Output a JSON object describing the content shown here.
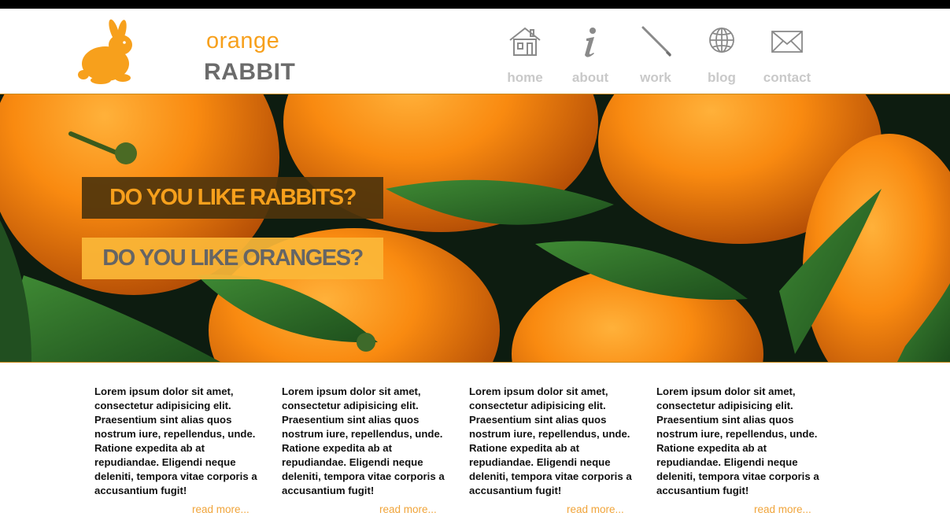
{
  "brand": {
    "line1": "orange",
    "line2": "RABBIT"
  },
  "colors": {
    "accent": "#f7a01c",
    "text_gray": "#6b6b6b",
    "nav_gray": "#c9c9c9"
  },
  "nav": [
    {
      "label": "home",
      "icon": "house-icon"
    },
    {
      "label": "about",
      "icon": "info-icon"
    },
    {
      "label": "work",
      "icon": "pencil-icon"
    },
    {
      "label": "blog",
      "icon": "globe-icon"
    },
    {
      "label": "contact",
      "icon": "envelope-icon"
    }
  ],
  "hero": {
    "headline1": "DO YOU LIKE RABBITS?",
    "headline2": "DO YOU LIKE ORANGES?"
  },
  "columns": [
    {
      "text": "Lorem ipsum dolor sit amet, consectetur adipisicing elit. Praesentium sint alias quos nostrum iure, repellendus, unde. Ratione expedita ab at repudiandae. Eligendi neque deleniti, tempora vitae corporis a accusantium fugit!",
      "link": "read more..."
    },
    {
      "text": "Lorem ipsum dolor sit amet, consectetur adipisicing elit. Praesentium sint alias quos nostrum iure, repellendus, unde. Ratione expedita ab at repudiandae. Eligendi neque deleniti, tempora vitae corporis a accusantium fugit!",
      "link": "read more..."
    },
    {
      "text": "Lorem ipsum dolor sit amet, consectetur adipisicing elit. Praesentium sint alias quos nostrum iure, repellendus, unde. Ratione expedita ab at repudiandae. Eligendi neque deleniti, tempora vitae corporis a accusantium fugit!",
      "link": "read more..."
    },
    {
      "text": "Lorem ipsum dolor sit amet, consectetur adipisicing elit. Praesentium sint alias quos nostrum iure, repellendus, unde. Ratione expedita ab at repudiandae. Eligendi neque deleniti, tempora vitae corporis a accusantium fugit!",
      "link": "read more..."
    }
  ]
}
